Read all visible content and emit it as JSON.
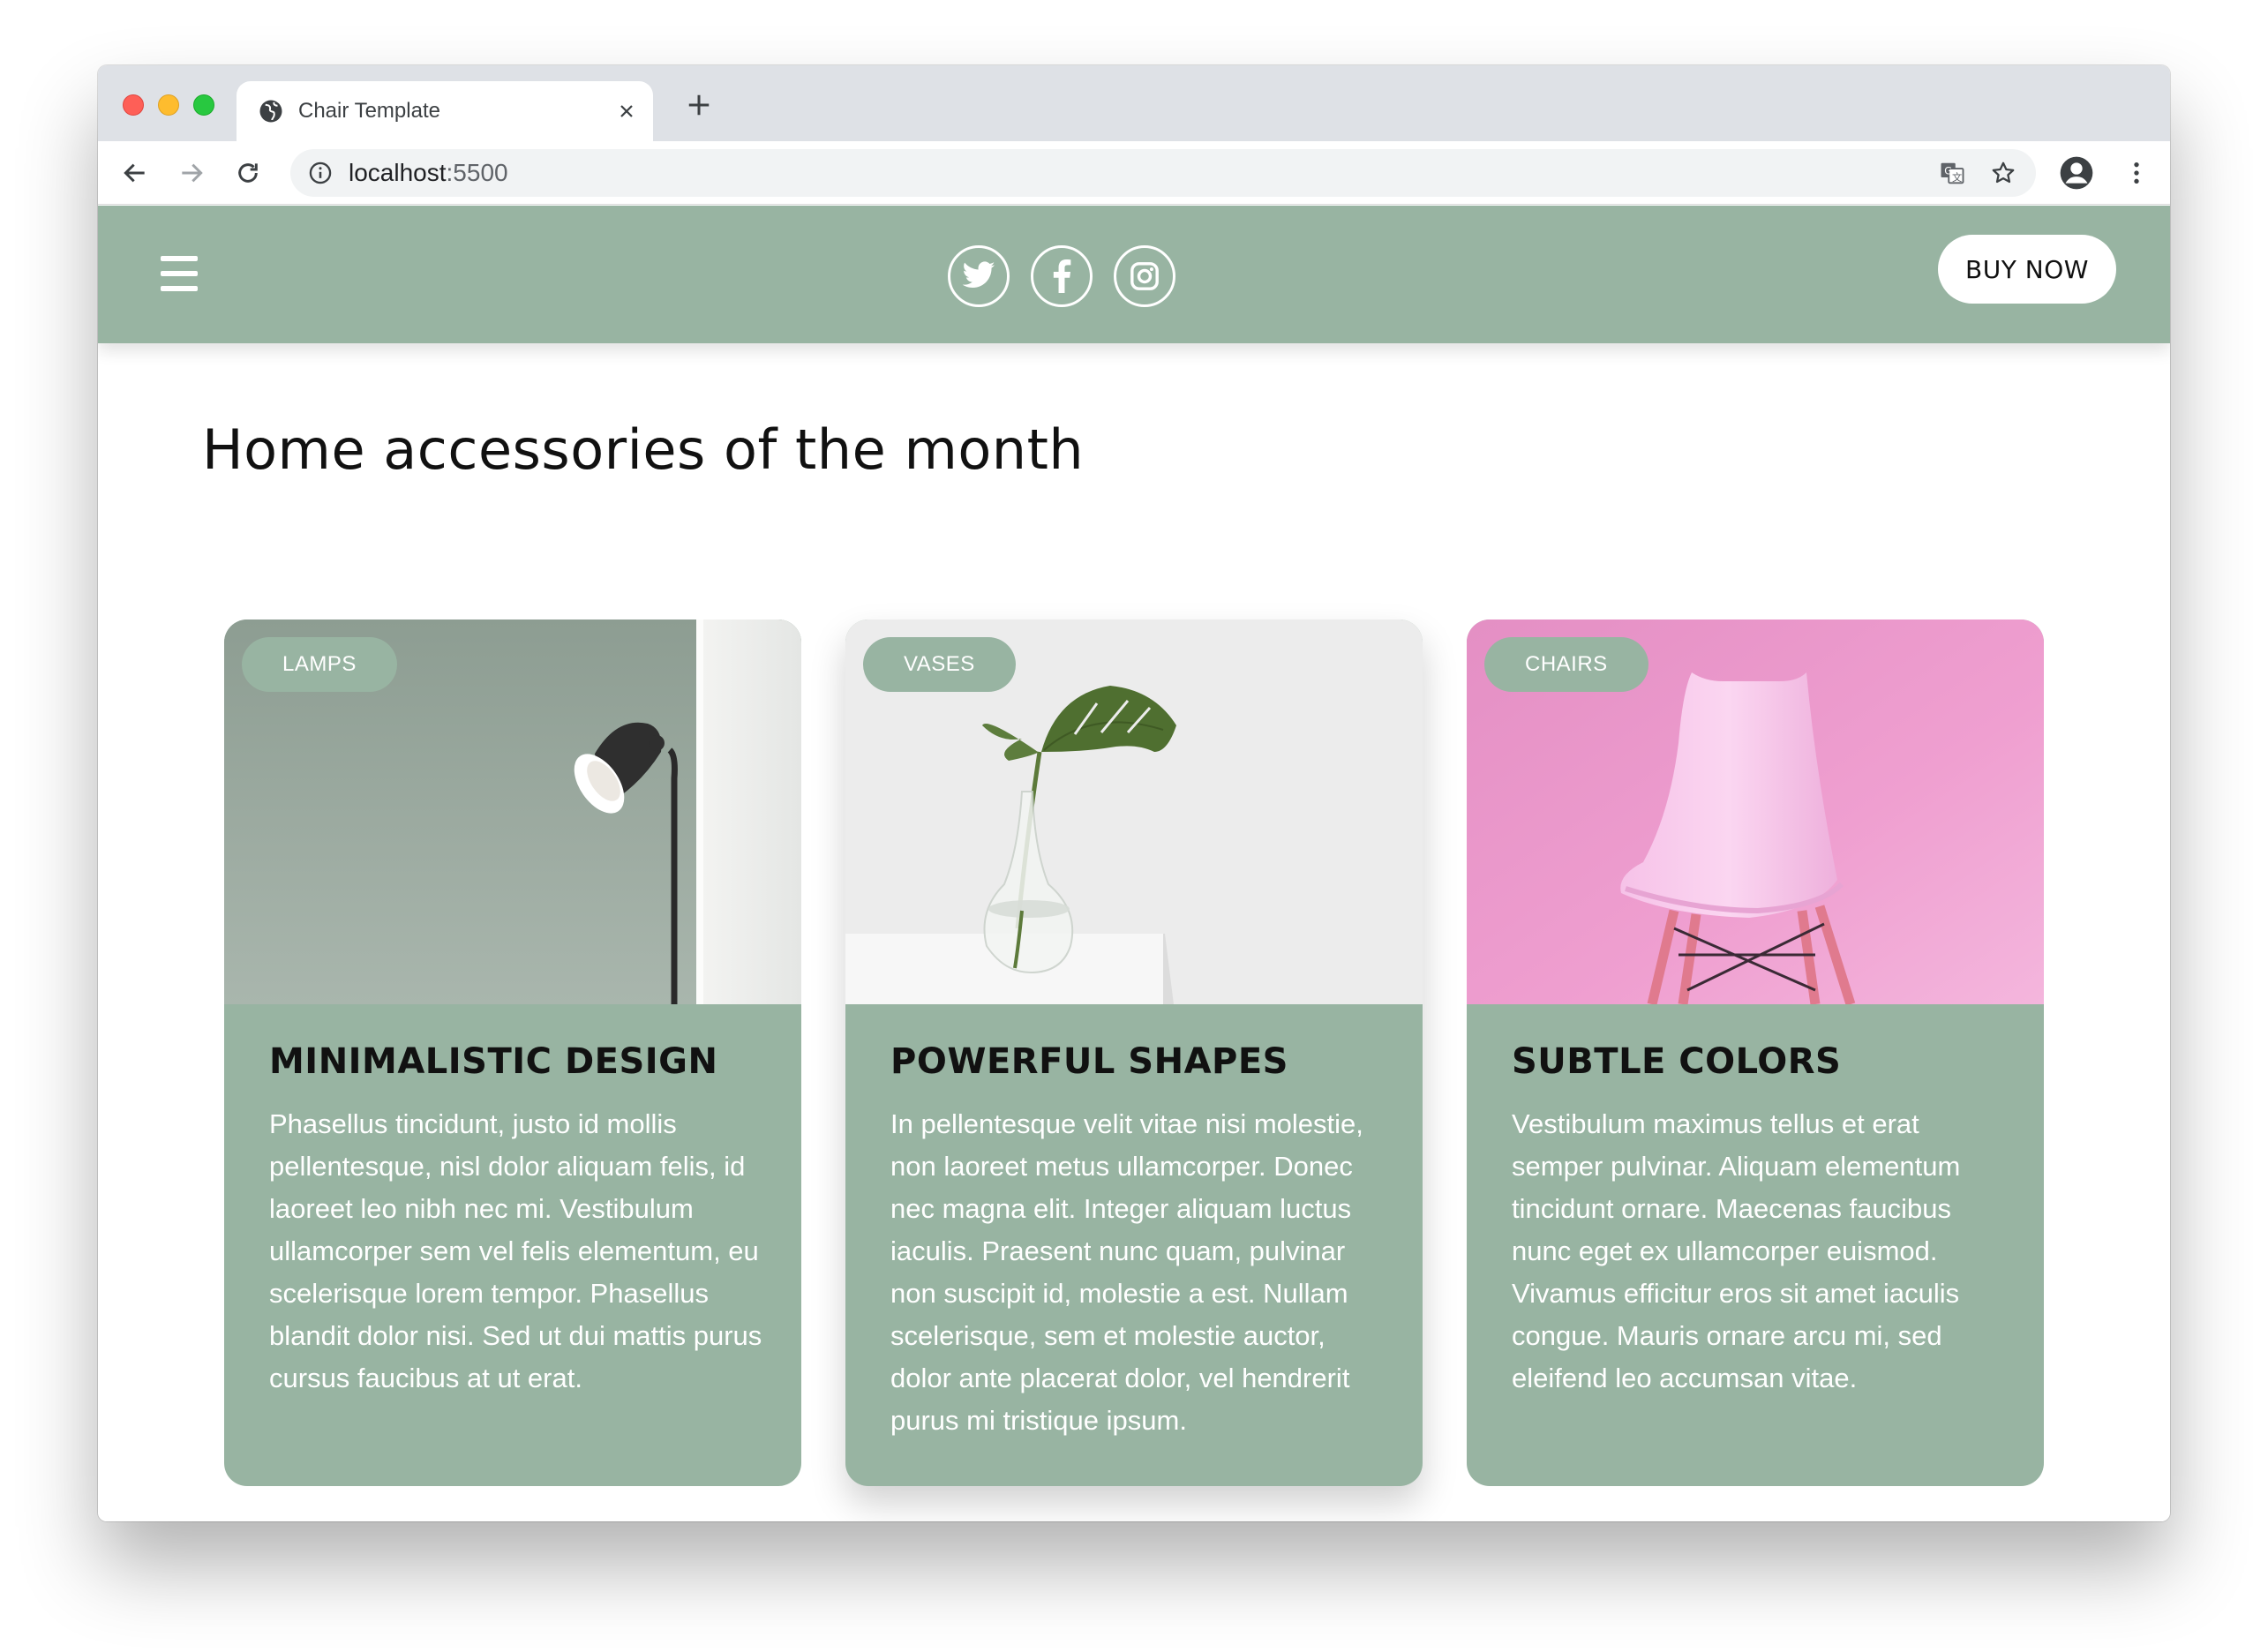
{
  "browser": {
    "tab_title": "Chair Template",
    "url_host": "localhost",
    "url_port": ":5500"
  },
  "site": {
    "buy_now_label": "BUY NOW",
    "page_title": "Home accessories of the month",
    "accent_color": "#98b4a2"
  },
  "cards": [
    {
      "badge": "LAMPS",
      "title": "MINIMALISTIC DESIGN",
      "body": "Phasellus tincidunt, justo id mollis pellentesque, nisl dolor aliquam felis, id laoreet leo nibh nec mi. Vestibulum ullamcorper sem vel felis elementum, eu scelerisque lorem tempor. Phasellus blandit dolor nisi. Sed ut dui mattis purus cursus faucibus at ut erat."
    },
    {
      "badge": "VASES",
      "title": "POWERFUL SHAPES",
      "body": "In pellentesque velit vitae nisi molestie, non laoreet metus ullamcorper. Donec nec magna elit. Integer aliquam luctus iaculis. Praesent nunc quam, pulvinar non suscipit id, molestie a est. Nullam scelerisque, sem et molestie auctor, dolor ante placerat dolor, vel hendrerit purus mi tristique ipsum."
    },
    {
      "badge": "CHAIRS",
      "title": "SUBTLE COLORS",
      "body": "Vestibulum maximus tellus et erat semper pulvinar. Aliquam elementum tincidunt ornare. Maecenas faucibus nunc eget ex ullamcorper euismod. Vivamus efficitur eros sit amet iaculis congue. Mauris ornare arcu mi, sed eleifend leo accumsan vitae."
    }
  ],
  "icons": {
    "social": [
      "twitter-icon",
      "facebook-icon",
      "instagram-icon"
    ]
  }
}
